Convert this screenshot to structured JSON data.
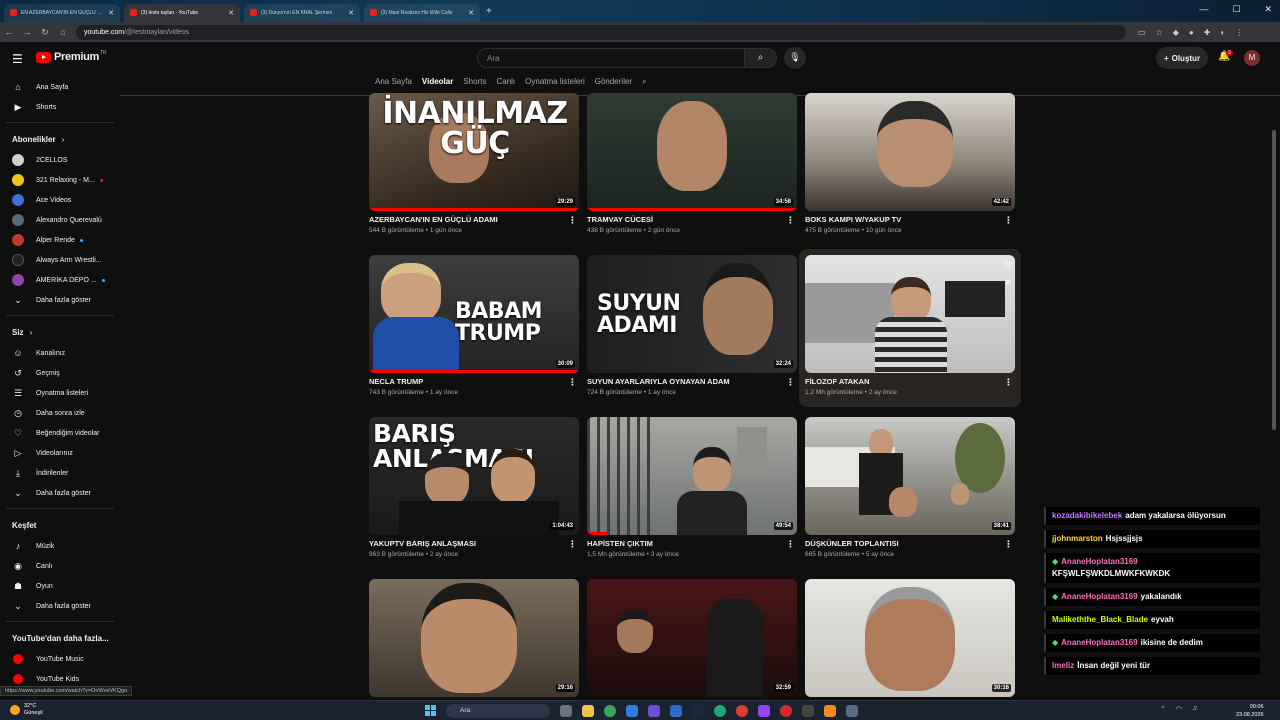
{
  "browser": {
    "tabs": [
      {
        "label": "EN AZERBAYCAN'IN EN GÜÇLÜ ADAMI",
        "active": false
      },
      {
        "label": "(3) testo taylan - YouTube",
        "active": true
      },
      {
        "label": "(3) Dünya'nın EN KRAL Şermes",
        "active": false
      },
      {
        "label": "(3) Mani Realizes His Wife Calls",
        "active": false
      }
    ],
    "url_host": "youtube.com",
    "url_path": "/@testotaylan/videos"
  },
  "header": {
    "logo_text": "Premium",
    "logo_sup": "TR",
    "search_placeholder": "Ara",
    "create_label": "Oluştur",
    "notif_count": "3",
    "avatar_letter": "M"
  },
  "sidebar": {
    "main": [
      {
        "label": "Ana Sayfa",
        "icon": "home-icon"
      },
      {
        "label": "Shorts",
        "icon": "shorts-icon"
      }
    ],
    "subs_title": "Abonelikler",
    "subs": [
      {
        "label": "2CELLOS",
        "color": "#cfcfcf",
        "dot": false
      },
      {
        "label": "321 Relaxing - M...",
        "color": "#f0c419",
        "dot": true
      },
      {
        "label": "Ace Videos",
        "color": "#3b6fd6",
        "dot": false
      },
      {
        "label": "Alexandro Querevalú",
        "color": "#556a7a",
        "dot": false
      },
      {
        "label": "Alper Rende",
        "color": "#c0392b",
        "dot": true
      },
      {
        "label": "Always Arm Wrestli...",
        "color": "#222222",
        "dot": false
      },
      {
        "label": "AMERİKA DEPO ...",
        "color": "#8e44ad",
        "dot": true
      }
    ],
    "subs_more": "Daha fazla göster",
    "you_title": "Siz",
    "you": [
      {
        "label": "Kanalınız",
        "icon": "channel-icon",
        "glyph": "☺"
      },
      {
        "label": "Geçmiş",
        "icon": "history-icon",
        "glyph": "↺"
      },
      {
        "label": "Oynatma listeleri",
        "icon": "playlist-icon",
        "glyph": "☰"
      },
      {
        "label": "Daha sonra izle",
        "icon": "clock-icon",
        "glyph": "◷"
      },
      {
        "label": "Beğendiğim videolar",
        "icon": "thumbs-up-icon",
        "glyph": "👍"
      },
      {
        "label": "Videolarınız",
        "icon": "video-icon",
        "glyph": "▷"
      },
      {
        "label": "İndirilenler",
        "icon": "download-icon",
        "glyph": "⤓"
      }
    ],
    "you_more": "Daha fazla göster",
    "explore_title": "Keşfet",
    "explore": [
      {
        "label": "Müzik",
        "icon": "music-icon",
        "glyph": "♪"
      },
      {
        "label": "Canlı",
        "icon": "live-icon",
        "glyph": "◉"
      },
      {
        "label": "Oyun",
        "icon": "gaming-icon",
        "glyph": "🎮"
      }
    ],
    "explore_more": "Daha fazla göster",
    "more_title": "YouTube'dan daha fazla...",
    "more": [
      {
        "label": "YouTube Music"
      },
      {
        "label": "YouTube Kids"
      }
    ]
  },
  "channel_tabs": [
    "Ana Sayfa",
    "Videolar",
    "Shorts",
    "Canlı",
    "Oynatma listeleri",
    "Gönderiler"
  ],
  "videos": [
    {
      "title": "AZERBAYCAN'IN EN GÜÇLÜ ADAMI",
      "meta": "544 B görüntüleme • 1 gün önce",
      "duration": "29:29",
      "thumb_text": "İNANILMAZ GÜÇ",
      "progress": 1.0
    },
    {
      "title": "TRAMVAY CÜCESİ",
      "meta": "438 B görüntüleme • 2 gün önce",
      "duration": "34:58",
      "thumb_text": "",
      "progress": 1.0
    },
    {
      "title": "BOKS KAMPI W/YAKUP TV",
      "meta": "475 B görüntüleme • 10 gün önce",
      "duration": "42:42",
      "thumb_text": "",
      "progress": 0
    },
    {
      "title": "NECLA TRUMP",
      "meta": "743 B görüntüleme • 1 ay önce",
      "duration": "30:09",
      "thumb_text": "BABAM TRUMP",
      "progress": 1.0
    },
    {
      "title": "SUYUN AYARLARIYLA OYNAYAN ADAM",
      "meta": "724 B görüntüleme • 1 ay önce",
      "duration": "32:24",
      "thumb_text": "SUYUN ADAMI",
      "progress": 0
    },
    {
      "title": "FİLOZOF ATAKAN",
      "meta": "1,2 Mn görüntüleme • 2 ay önce",
      "duration": "",
      "thumb_text": "",
      "progress": 0
    },
    {
      "title": "YAKUPTV BARIŞ ANLAŞMASI",
      "meta": "963 B görüntüleme • 2 ay önce",
      "duration": "1:04:43",
      "thumb_text": "BARIŞ ANLAŞMASI",
      "progress": 0
    },
    {
      "title": "HAPİSTEN ÇIKTIM",
      "meta": "1,5 Mn görüntüleme • 3 ay önce",
      "duration": "49:54",
      "thumb_text": "",
      "progress": 0.1
    },
    {
      "title": "DÜŞKÜNLER TOPLANTISI",
      "meta": "665 B görüntüleme • 5 ay önce",
      "duration": "38:41",
      "thumb_text": "",
      "progress": 0
    },
    {
      "title": "",
      "meta": "",
      "duration": "29:16",
      "thumb_text": "",
      "progress": 0
    },
    {
      "title": "",
      "meta": "",
      "duration": "32:59",
      "thumb_text": "",
      "progress": 0
    },
    {
      "title": "",
      "meta": "",
      "duration": "30:16",
      "thumb_text": "",
      "progress": 0
    }
  ],
  "chat": [
    {
      "user": "kozadakibikelebek",
      "text": "adam yakalarsa ölüyorsun",
      "color": "#c77dff",
      "gem": false
    },
    {
      "user": "jjohnmarston",
      "text": "Hsjssjjsjs",
      "color": "#ffd54f",
      "gem": false
    },
    {
      "user": "AnaneHoplatan3169",
      "text": "KFŞWLFŞWKDLMWKFKWKDK",
      "color": "#ff6eb4",
      "gem": true
    },
    {
      "user": "AnaneHoplatan3169",
      "text": "yakalandık",
      "color": "#ff6eb4",
      "gem": true
    },
    {
      "user": "Malikeththe_Black_Blade",
      "text": "eyvah",
      "color": "#c6ff00",
      "gem": false
    },
    {
      "user": "AnaneHoplatan3169",
      "text": "ikisine de dedim",
      "color": "#ff6eb4",
      "gem": true
    },
    {
      "user": "Imeliz",
      "text": "İnsan değil yeni tür",
      "color": "#ff6eb4",
      "gem": false
    }
  ],
  "status_url": "https://www.youtube.com/watch?v=OnWveVKQgo",
  "taskbar": {
    "weather_temp": "32°C",
    "weather_desc": "Güneşli",
    "search": "Ara",
    "time": "00:06",
    "date": "23.08.2026"
  }
}
